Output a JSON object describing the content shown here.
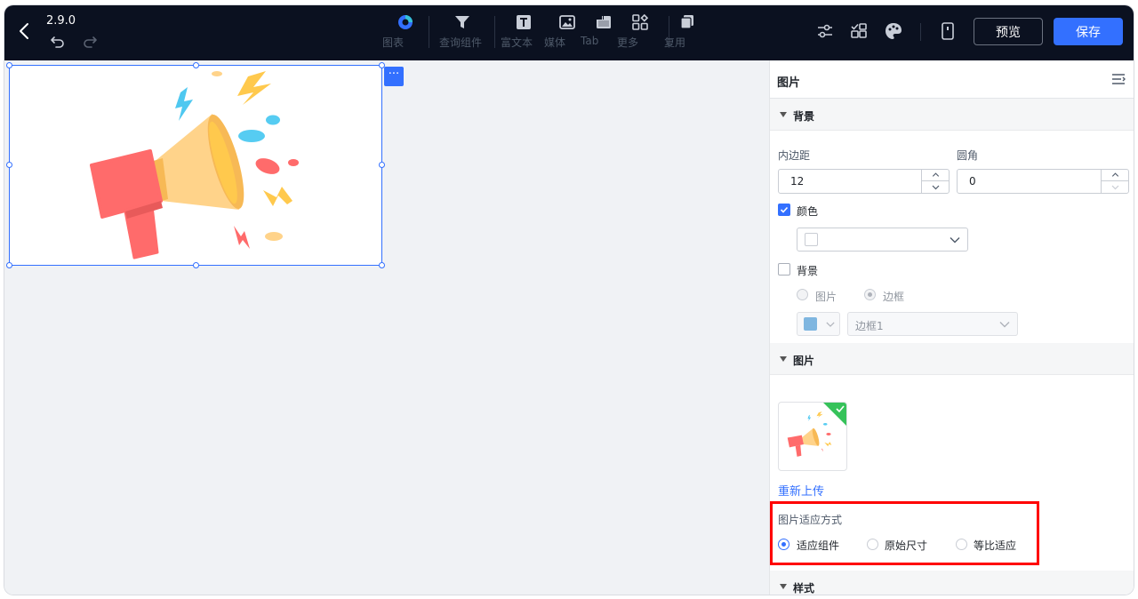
{
  "topbar": {
    "version": "2.9.0",
    "tools": [
      {
        "label": "图表",
        "icon": "chart-icon"
      },
      {
        "label": "查询组件",
        "icon": "filter-icon"
      },
      {
        "label": "富文本",
        "icon": "rich-text-icon"
      },
      {
        "label": "媒体",
        "icon": "media-icon"
      },
      {
        "label": "Tab",
        "icon": "tab-icon"
      },
      {
        "label": "更多",
        "icon": "more-components-icon"
      },
      {
        "label": "复用",
        "icon": "reuse-icon"
      }
    ],
    "preview_label": "预览",
    "save_label": "保存",
    "save_color": "#3370ff"
  },
  "panel": {
    "title": "图片",
    "background_section": {
      "title": "背景",
      "padding_label": "内边距",
      "padding_value": "12",
      "radius_label": "圆角",
      "radius_value": "0",
      "color_label": "颜色",
      "color_checked": true,
      "bg_label": "背景",
      "bg_checked": false,
      "bg_options": [
        "图片",
        "边框"
      ],
      "bg_option_selected": "边框",
      "border_select_value": "边框1",
      "border_swatch_color": "#7fb6e0"
    },
    "image_section": {
      "title": "图片",
      "reupload_label": "重新上传",
      "fit_label": "图片适应方式",
      "fit_options": [
        "适应组件",
        "原始尺寸",
        "等比适应"
      ],
      "fit_selected": "适应组件"
    },
    "style_section": {
      "title": "样式"
    }
  }
}
